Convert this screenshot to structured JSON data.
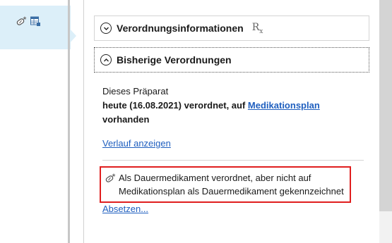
{
  "header_section": {
    "label": "Verordnungsinformationen",
    "rx_symbol": "R",
    "rx_sub": "x"
  },
  "history_section": {
    "label": "Bisherige Verordnungen"
  },
  "info": {
    "line1": "Dieses Präparat",
    "line2_prefix": "heute (16.08.2021) verordnet, auf ",
    "line2_link": "Medikationsplan",
    "line3": "vorhanden"
  },
  "links": {
    "history": "Verlauf anzeigen",
    "stop": "Absetzen..."
  },
  "warning": {
    "text": "Als Dauermedikament verordnet, aber nicht auf Medikationsplan als Dauermedikament gekennzeichnet"
  },
  "icons": {
    "left_pill": "pill-star-icon",
    "left_table": "table-icon",
    "expand": "chevron-down-icon",
    "collapse": "chevron-up-icon"
  },
  "colors": {
    "accent": "#1f5fbf",
    "warning_border": "#e01e1e",
    "tab_bg": "#dceff9"
  }
}
